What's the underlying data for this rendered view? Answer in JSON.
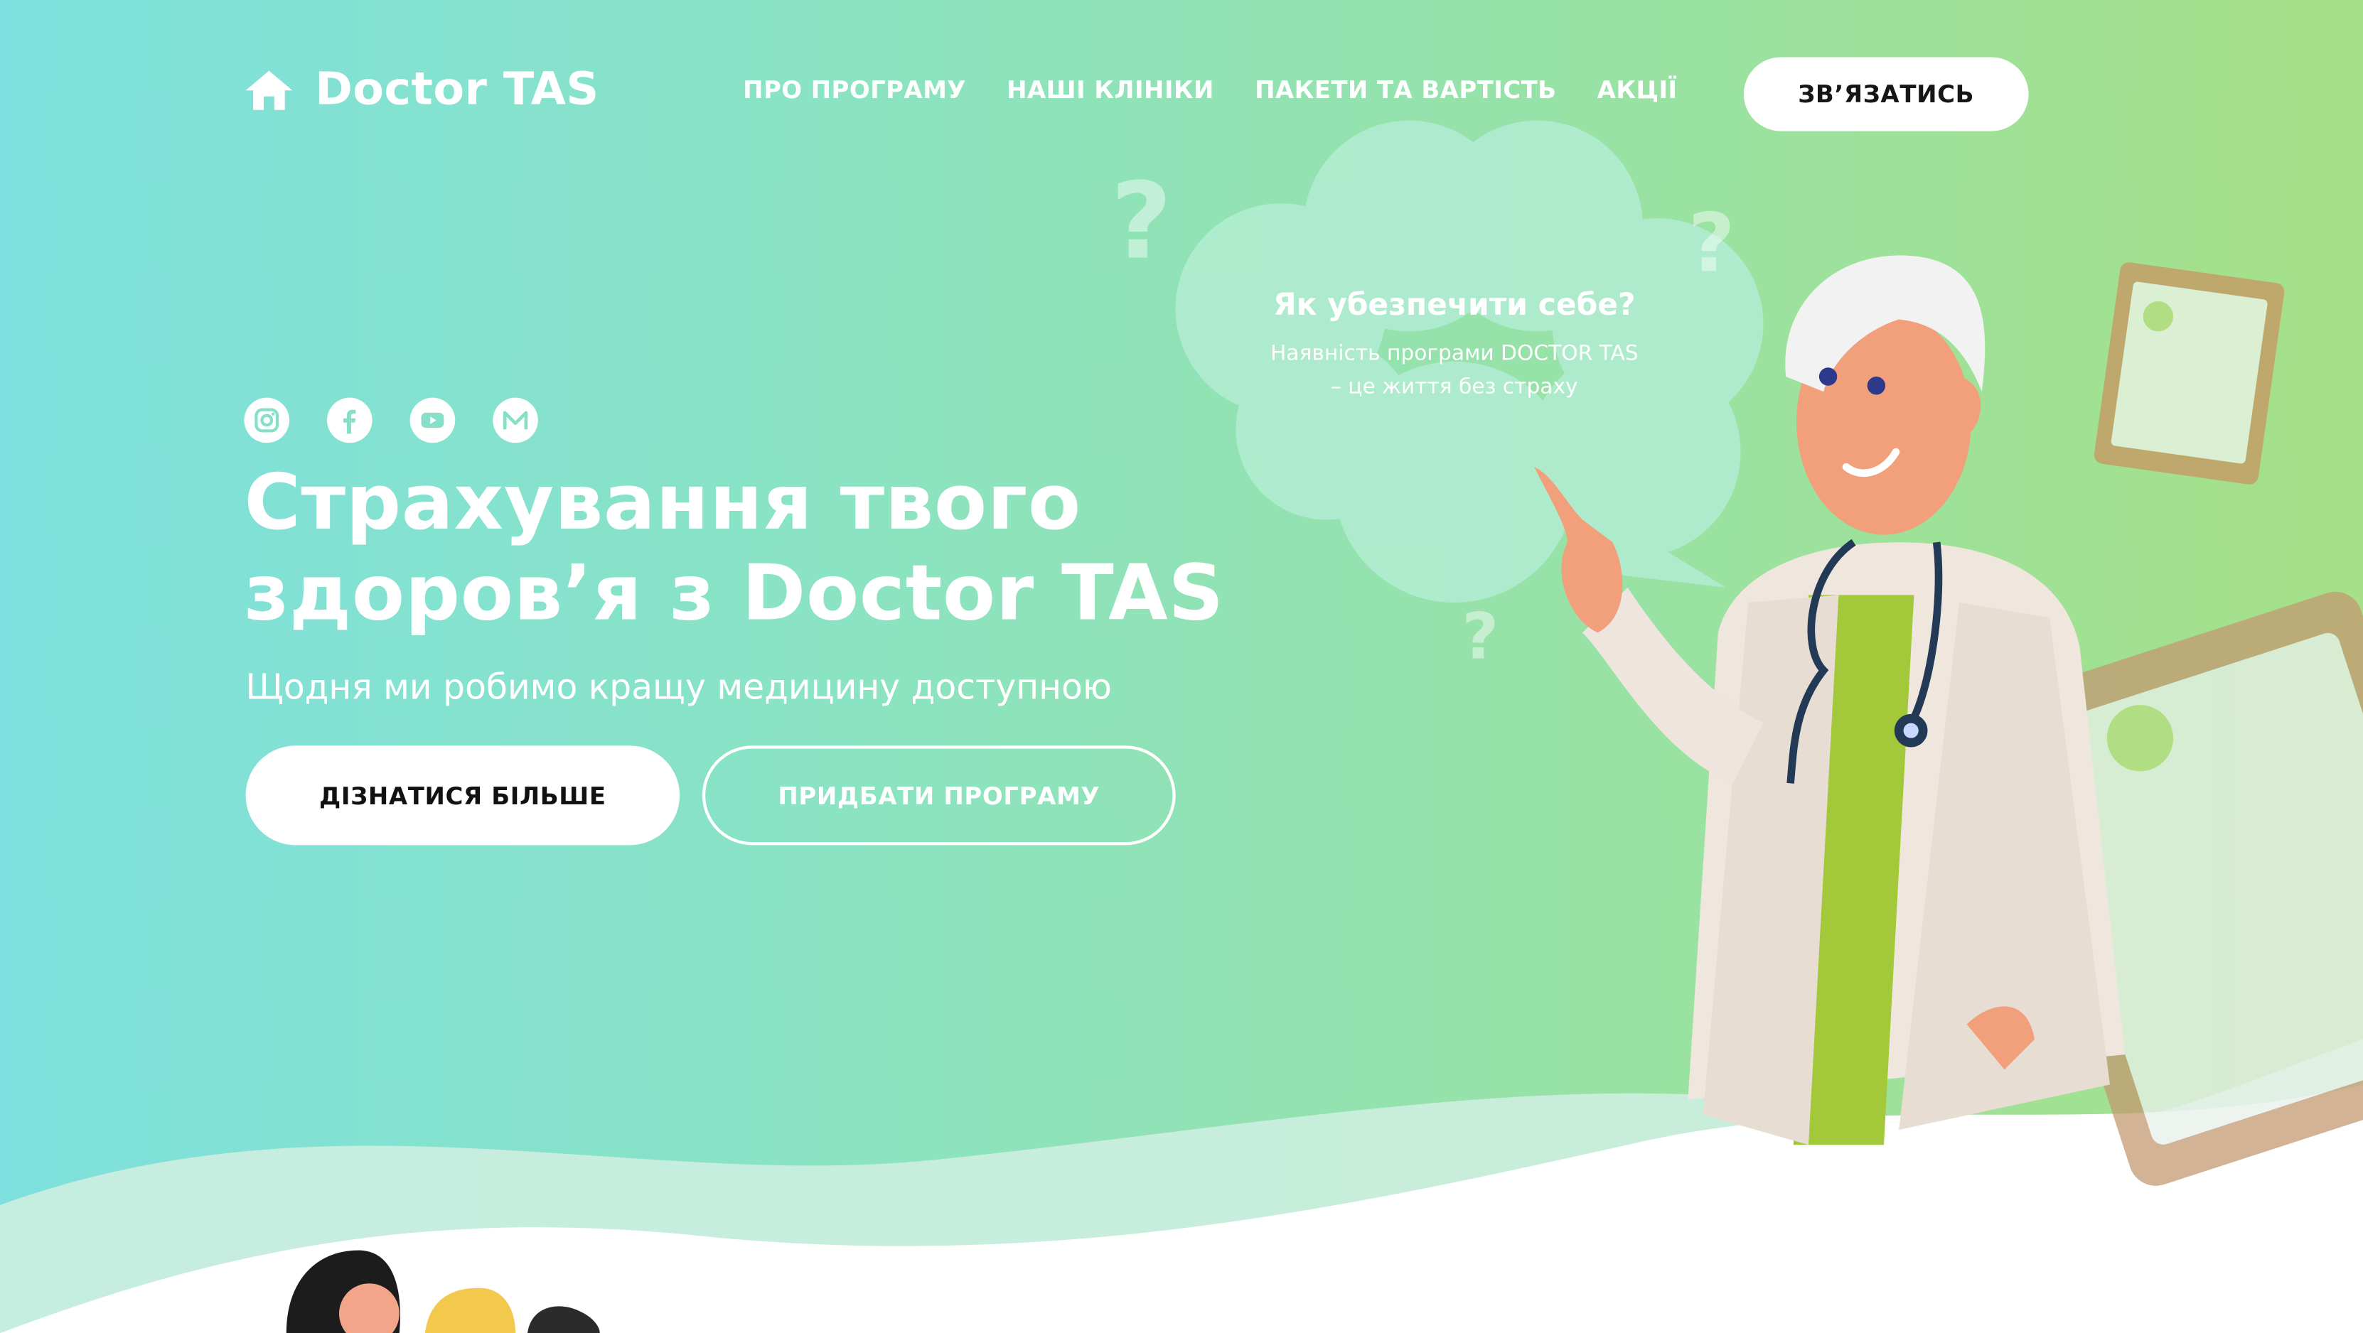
{
  "header": {
    "logo_text": "Doctor TAS",
    "nav": [
      {
        "label": "ПРО ПРОГРАМУ"
      },
      {
        "label": "НАШІ КЛІНІКИ"
      },
      {
        "label": "ПАКЕТИ ТА ВАРТІСТЬ"
      },
      {
        "label": "АКЦІЇ"
      }
    ],
    "contact_label": "ЗВ’ЯЗАТИСЬ"
  },
  "socials": [
    {
      "icon": "instagram-icon"
    },
    {
      "icon": "facebook-icon"
    },
    {
      "icon": "youtube-icon"
    },
    {
      "icon": "mail-icon"
    }
  ],
  "hero": {
    "title_line1": "Страхування твого",
    "title_line2": "здоров’я з Doctor TAS",
    "subtitle": "Щодня ми робимо кращу медицину доступною",
    "primary_button": "ДІЗНАТИСЯ БІЛЬШЕ",
    "secondary_button": "ПРИДБАТИ ПРОГРАМУ"
  },
  "bubble": {
    "title": "Як убезпечити себе?",
    "body": "Наявність програми DOCTOR TAS – це життя без страху"
  },
  "decor": {
    "question_mark": "?"
  },
  "colors": {
    "gradient_left": "#7ee0de",
    "gradient_right": "#a6e088",
    "text": "#ffffff",
    "button_text": "#111111",
    "scrub_green": "#a3c93b"
  }
}
